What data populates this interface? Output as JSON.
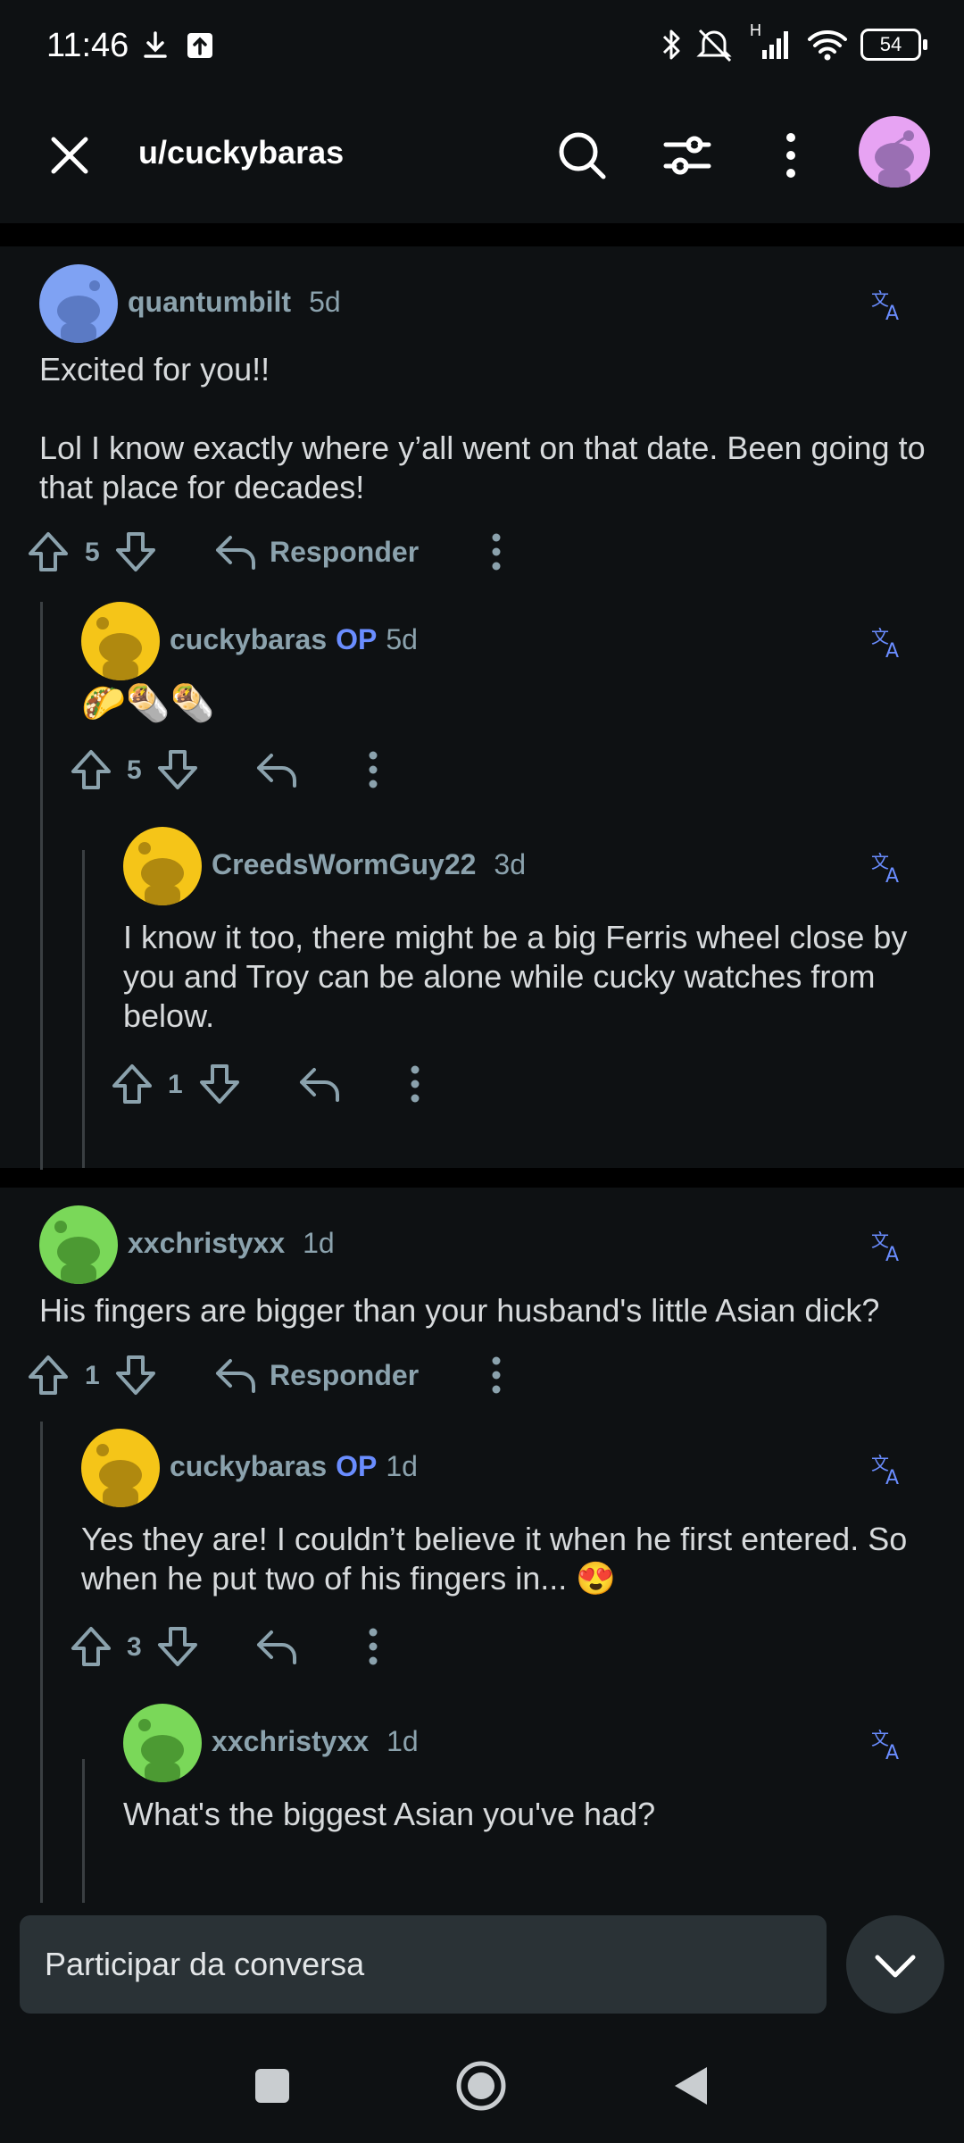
{
  "status_bar": {
    "time": "11:46",
    "battery": "54",
    "network": "H"
  },
  "top_bar": {
    "title": "u/cuckybaras"
  },
  "threads": [
    {
      "comments": [
        {
          "username": "quantumbilt",
          "op": "",
          "age": "5d",
          "text": "Excited for you!!\n\nLol I know exactly where y’all went on that date. Been going to that place for decades!",
          "votes": "5",
          "reply_label": "Responder",
          "avatar_color": "#7fa2f3"
        },
        {
          "username": "cuckybaras",
          "op": "OP",
          "age": "5d",
          "text": "🌮🌯🌯",
          "votes": "5",
          "reply_label": "",
          "avatar_color": "#f5c518"
        },
        {
          "username": "CreedsWormGuy22",
          "op": "",
          "age": "3d",
          "text": "I know it too, there might be a big Ferris wheel close by you and Troy can be alone while cucky watches from below.",
          "votes": "1",
          "reply_label": "",
          "avatar_color": "#f5c518"
        }
      ]
    },
    {
      "comments": [
        {
          "username": "xxchristyxx",
          "op": "",
          "age": "1d",
          "text": "His fingers are bigger than your husband's little Asian dick?",
          "votes": "1",
          "reply_label": "Responder",
          "avatar_color": "#7ad859"
        },
        {
          "username": "cuckybaras",
          "op": "OP",
          "age": "1d",
          "text": "Yes they are! I couldn’t believe it when he first entered. So when he put two of his fingers in... 😍",
          "votes": "3",
          "reply_label": "",
          "avatar_color": "#f5c518"
        },
        {
          "username": "xxchristyxx",
          "op": "",
          "age": "1d",
          "text": "What's the biggest Asian you've had?",
          "votes": "",
          "reply_label": "",
          "avatar_color": "#7ad859"
        }
      ]
    }
  ],
  "composer": {
    "placeholder": "Participar da conversa"
  },
  "colors": {
    "background": "#0e1113",
    "accent_op": "#6a8dff",
    "meta_text": "#8ba2ad"
  }
}
